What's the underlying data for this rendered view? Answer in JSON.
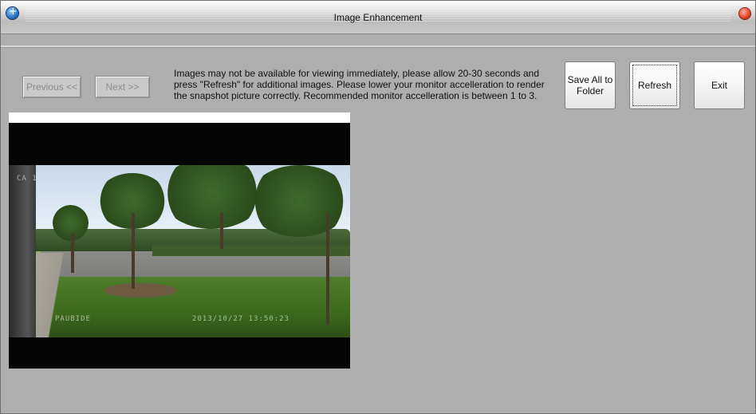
{
  "window": {
    "title": "Image Enhancement"
  },
  "nav": {
    "previous_label": "Previous <<",
    "next_label": "Next >>"
  },
  "notice": {
    "text": "Images may not be available for viewing immediately, please allow 20-30 seconds and press \"Refresh\" for additional images. Please lower your monitor accelleration to render the snapshot picture correctly. Recommended monitor accelleration is between 1 to 3."
  },
  "actions": {
    "save_line1": "Save All to",
    "save_line2": "Folder",
    "refresh_label": "Refresh",
    "exit_label": "Exit"
  },
  "snapshot": {
    "channel": "CA 1",
    "camera": "PAUBIDE",
    "timestamp": "2013/10/27 13:50:23"
  },
  "colors": {
    "window_bg": "#aeaeae",
    "close_button": "#e0401f",
    "app_icon": "#1a5fb4"
  }
}
